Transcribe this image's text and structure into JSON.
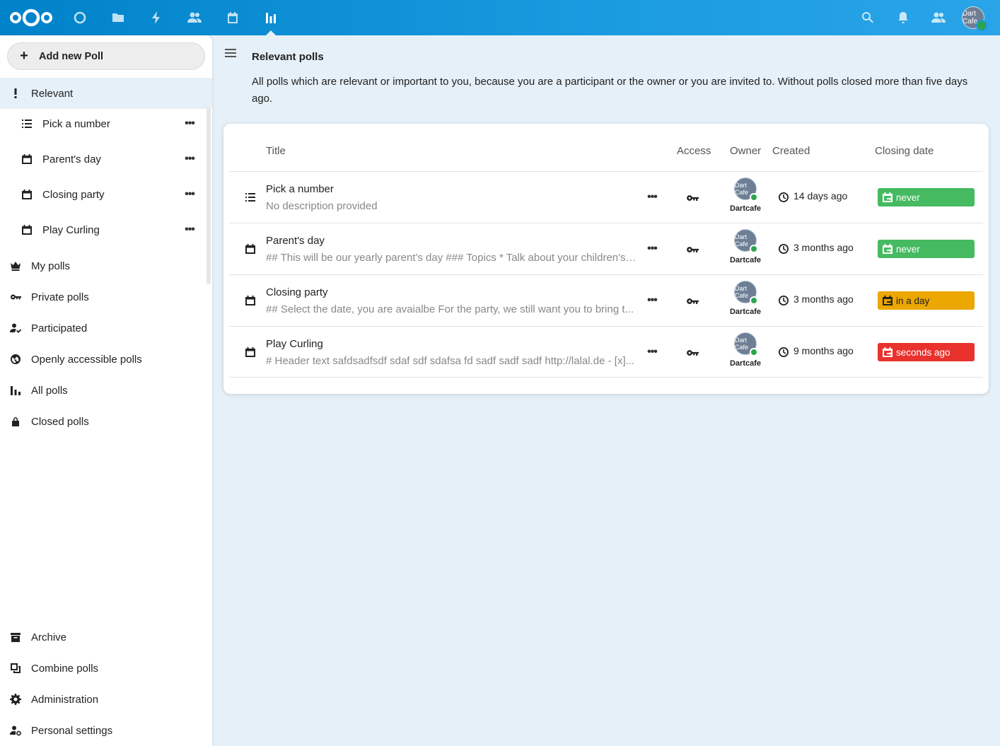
{
  "header": {
    "apps": [
      "dashboard",
      "files",
      "activity",
      "contacts",
      "calendar",
      "polls"
    ],
    "user_avatar_text": "Dart Cafe"
  },
  "sidebar": {
    "add_poll_label": "Add new Poll",
    "relevant_label": "Relevant",
    "polls": [
      {
        "label": "Pick a number",
        "icon": "list-icon"
      },
      {
        "label": "Parent's day",
        "icon": "calendar-icon"
      },
      {
        "label": "Closing party",
        "icon": "calendar-icon"
      },
      {
        "label": "Play Curling",
        "icon": "calendar-icon"
      }
    ],
    "nav": [
      {
        "label": "My polls",
        "icon": "crown-icon"
      },
      {
        "label": "Private polls",
        "icon": "key-icon"
      },
      {
        "label": "Participated",
        "icon": "user-check-icon"
      },
      {
        "label": "Openly accessible polls",
        "icon": "globe-icon"
      },
      {
        "label": "All polls",
        "icon": "bar-chart-icon"
      },
      {
        "label": "Closed polls",
        "icon": "lock-icon"
      }
    ],
    "footer": [
      {
        "label": "Archive",
        "icon": "archive-icon"
      },
      {
        "label": "Combine polls",
        "icon": "combine-icon"
      },
      {
        "label": "Administration",
        "icon": "gear-icon"
      },
      {
        "label": "Personal settings",
        "icon": "user-gear-icon"
      }
    ]
  },
  "main": {
    "title": "Relevant polls",
    "description": "All polls which are relevant or important to you, because you are a participant or the owner or you are invited to. Without polls closed more than five days ago.",
    "columns": {
      "title": "Title",
      "access": "Access",
      "owner": "Owner",
      "created": "Created",
      "closing": "Closing date"
    },
    "rows": [
      {
        "type": "list-icon",
        "title": "Pick a number",
        "description": "No description provided",
        "owner": "Dartcafe",
        "avatar_text": "Dart Cafe",
        "created": "14 days ago",
        "closing": "never",
        "closing_color": "#46ba61"
      },
      {
        "type": "calendar-icon",
        "title": "Parent's day",
        "description": "## This will be our yearly parent's day ### Topics * Talk about your children's ...",
        "owner": "Dartcafe",
        "avatar_text": "Dart Cafe",
        "created": "3 months ago",
        "closing": "never",
        "closing_color": "#46ba61"
      },
      {
        "type": "calendar-icon",
        "title": "Closing party",
        "description": "## Select the date, you are avaialbe For the party, we still want you to bring t...",
        "owner": "Dartcafe",
        "avatar_text": "Dart Cafe",
        "created": "3 months ago",
        "closing": "in a day",
        "closing_color": "#eca700"
      },
      {
        "type": "calendar-icon",
        "title": "Play Curling",
        "description": "# Header text safdsadfsdf sdaf sdf sdafsa fd sadf sadf sadf http://lalal.de - [x]...",
        "owner": "Dartcafe",
        "avatar_text": "Dart Cafe",
        "created": "9 months ago",
        "closing": "seconds ago",
        "closing_color": "#e9322d"
      }
    ]
  },
  "colors": {
    "header": "#0082c9",
    "selected_bg": "#e6f0f8"
  }
}
